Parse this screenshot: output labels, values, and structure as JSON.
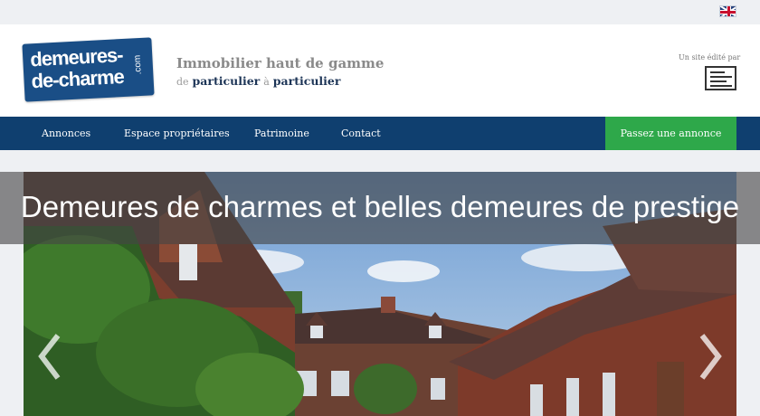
{
  "header": {
    "logo_line1": "demeures-",
    "logo_line2": "de-charme",
    "logo_domain": ".com",
    "tagline": "Immobilier haut de gamme",
    "sub_de": "de",
    "sub_particulier_1": "particulier",
    "sub_a": "à",
    "sub_particulier_2": "particulier",
    "edited_by": "Un site édité par",
    "language_icon": "uk-flag-icon"
  },
  "nav": {
    "items": [
      {
        "label": "Annonces"
      },
      {
        "label": "Espace propriétaires"
      },
      {
        "label": "Patrimoine"
      },
      {
        "label": "Contact"
      }
    ],
    "cta": "Passez une annonce"
  },
  "hero": {
    "headline": "Demeures de charmes et belles demeures de prestige",
    "prev_icon": "chevron-left-icon",
    "next_icon": "chevron-right-icon"
  },
  "colors": {
    "nav_bg": "#0f3f6f",
    "cta_bg": "#2ea84a",
    "logo_bg": "#1a4e86",
    "page_bg": "#eef0f3"
  }
}
